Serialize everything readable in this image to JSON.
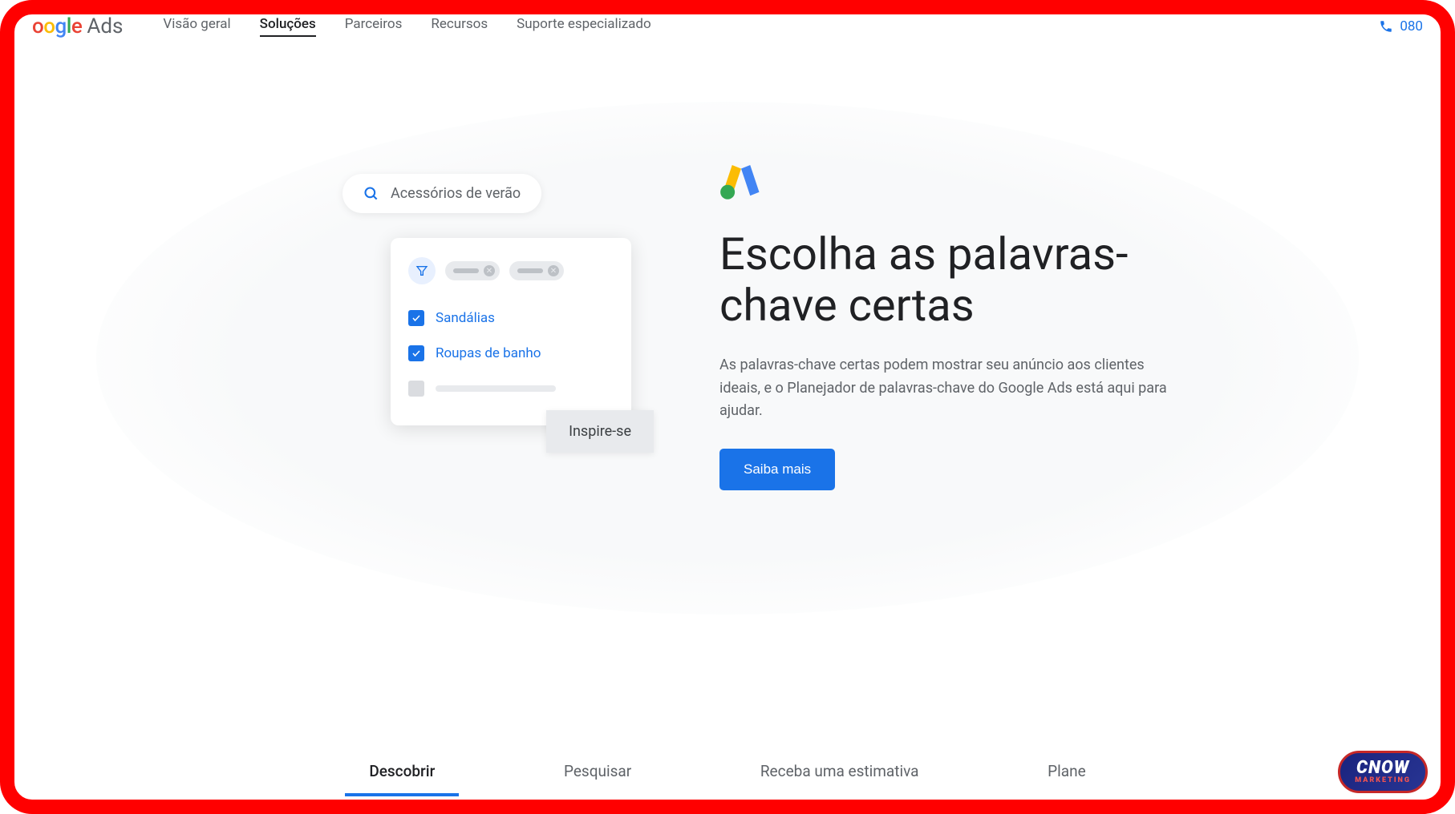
{
  "header": {
    "logo_product": "Ads",
    "nav": [
      {
        "label": "Visão geral",
        "active": false
      },
      {
        "label": "Soluções",
        "active": true
      },
      {
        "label": "Parceiros",
        "active": false
      },
      {
        "label": "Recursos",
        "active": false
      },
      {
        "label": "Suporte especializado",
        "active": false
      }
    ],
    "phone": "080"
  },
  "hero": {
    "search_text": "Acessórios de verão",
    "checklist": [
      {
        "label": "Sandálias",
        "checked": true
      },
      {
        "label": "Roupas de banho",
        "checked": true
      }
    ],
    "inspire_label": "Inspire-se",
    "headline": "Escolha as palavras-chave certas",
    "description": "As palavras-chave certas podem mostrar seu anúncio aos clientes ideais, e o Planejador de palavras-chave do Google Ads está aqui para ajudar.",
    "cta_label": "Saiba mais"
  },
  "tabs": [
    {
      "label": "Descobrir",
      "active": true
    },
    {
      "label": "Pesquisar",
      "active": false
    },
    {
      "label": "Receba uma estimativa",
      "active": false
    },
    {
      "label": "Plane",
      "active": false
    }
  ],
  "watermark": {
    "main": "CNOW",
    "sub": "MARKETING"
  }
}
